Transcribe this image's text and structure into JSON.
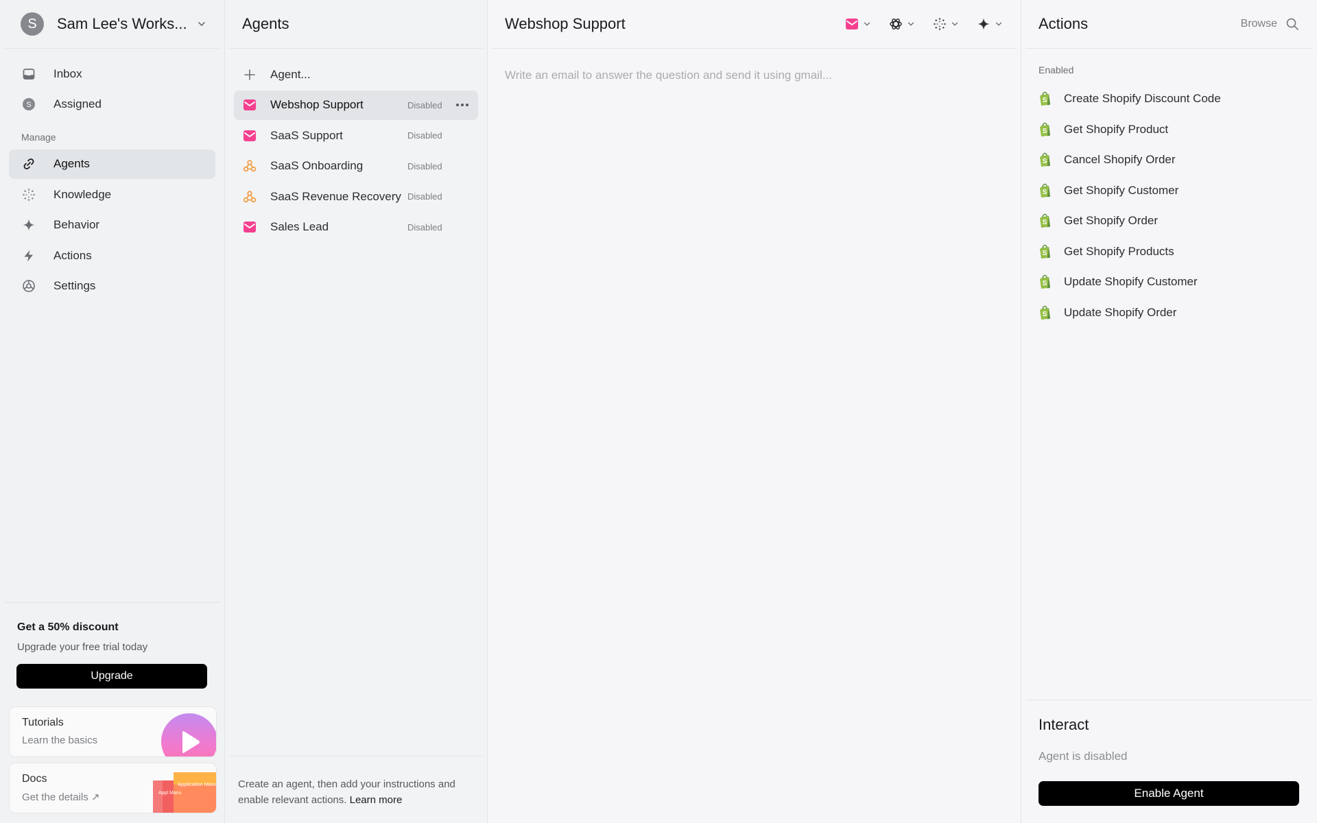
{
  "sidebar": {
    "workspace": {
      "avatar_letter": "S",
      "name": "Sam Lee's Works..."
    },
    "top_items": [
      {
        "label": "Inbox",
        "icon": "inbox-icon"
      },
      {
        "label": "Assigned",
        "icon": "avatar-s-icon",
        "avatar_letter": "S"
      }
    ],
    "manage_label": "Manage",
    "manage_items": [
      {
        "label": "Agents",
        "icon": "link-icon",
        "active": true
      },
      {
        "label": "Knowledge",
        "icon": "dotted-circle-icon"
      },
      {
        "label": "Behavior",
        "icon": "sparkle-icon"
      },
      {
        "label": "Actions",
        "icon": "bolt-icon"
      },
      {
        "label": "Settings",
        "icon": "settings-icon"
      }
    ],
    "promo": {
      "title": "Get a 50% discount",
      "subtitle": "Upgrade your free trial today",
      "button": "Upgrade"
    },
    "tutorials": {
      "title": "Tutorials",
      "subtitle": "Learn the basics"
    },
    "docs": {
      "title": "Docs",
      "subtitle": "Get the details ↗",
      "book_label": "Application Manual",
      "book_label_back": "Appl Manu"
    }
  },
  "agents_panel": {
    "title": "Agents",
    "add_label": "Agent...",
    "items": [
      {
        "label": "Webshop Support",
        "status": "Disabled",
        "icon": "mail-icon",
        "active": true
      },
      {
        "label": "SaaS Support",
        "status": "Disabled",
        "icon": "mail-icon"
      },
      {
        "label": "SaaS Onboarding",
        "status": "Disabled",
        "icon": "webhook-icon"
      },
      {
        "label": "SaaS Revenue Recovery",
        "status": "Disabled",
        "icon": "webhook-icon"
      },
      {
        "label": "Sales Lead",
        "status": "Disabled",
        "icon": "mail-icon"
      }
    ],
    "footer_text": "Create an agent, then add your instructions and enable relevant actions.",
    "footer_link": "Learn more"
  },
  "main": {
    "title": "Webshop Support",
    "placeholder": "Write an email to answer the question and send it using gmail...",
    "toolbar": [
      "mail-icon",
      "openai-icon",
      "dotted-circle-icon",
      "sparkle-icon"
    ]
  },
  "actions_panel": {
    "title": "Actions",
    "browse_label": "Browse",
    "enabled_label": "Enabled",
    "items": [
      "Create Shopify Discount Code",
      "Get Shopify Product",
      "Cancel Shopify Order",
      "Get Shopify Customer",
      "Get Shopify Order",
      "Get Shopify Products",
      "Update Shopify Customer",
      "Update Shopify Order"
    ],
    "interact": {
      "title": "Interact",
      "subtitle": "Agent is disabled",
      "button": "Enable Agent"
    }
  },
  "colors": {
    "accent_pink": "#f5408f",
    "webhook_orange": "#f2a04a",
    "shopify_green": "#95bf47",
    "button_black": "#000000"
  }
}
